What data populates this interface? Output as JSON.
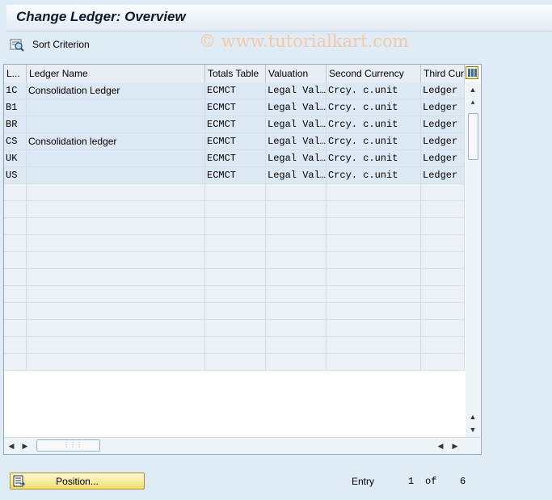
{
  "window": {
    "title": "Change Ledger: Overview"
  },
  "toolbar": {
    "sort_label": "Sort Criterion",
    "watermark": "© www.tutorialkart.com"
  },
  "table": {
    "columns": [
      "L...",
      "Ledger Name",
      "Totals Table",
      "Valuation",
      "Second Currency",
      "Third Cur"
    ],
    "rows": [
      [
        "1C",
        "Consolidation Ledger",
        "ECMCT",
        "Legal Val…",
        "Crcy. c.unit",
        "Ledger c"
      ],
      [
        "B1",
        "",
        "ECMCT",
        "Legal Val…",
        "Crcy. c.unit",
        "Ledger c"
      ],
      [
        "BR",
        "",
        "ECMCT",
        "Legal Val…",
        "Crcy. c.unit",
        "Ledger c"
      ],
      [
        "CS",
        "Consolidation ledger",
        "ECMCT",
        "Legal Val…",
        "Crcy. c.unit",
        "Ledger c"
      ],
      [
        "UK",
        "",
        "ECMCT",
        "Legal Val…",
        "Crcy. c.unit",
        "Ledger c"
      ],
      [
        "US",
        "",
        "ECMCT",
        "Legal Val…",
        "Crcy. c.unit",
        "Ledger c"
      ]
    ],
    "empty_rows": 11
  },
  "footer": {
    "position_label": "Position...",
    "entry_label": "Entry",
    "entry_current": "1",
    "of_label": "of",
    "entry_total": "6"
  },
  "colors": {
    "background": "#dfebf5",
    "row_filled": "#dce8f3",
    "button_yellow": "#f2dc6c"
  },
  "icons": {
    "sort": "sort-criterion-icon",
    "config": "table-settings-icon",
    "position": "position-icon"
  }
}
